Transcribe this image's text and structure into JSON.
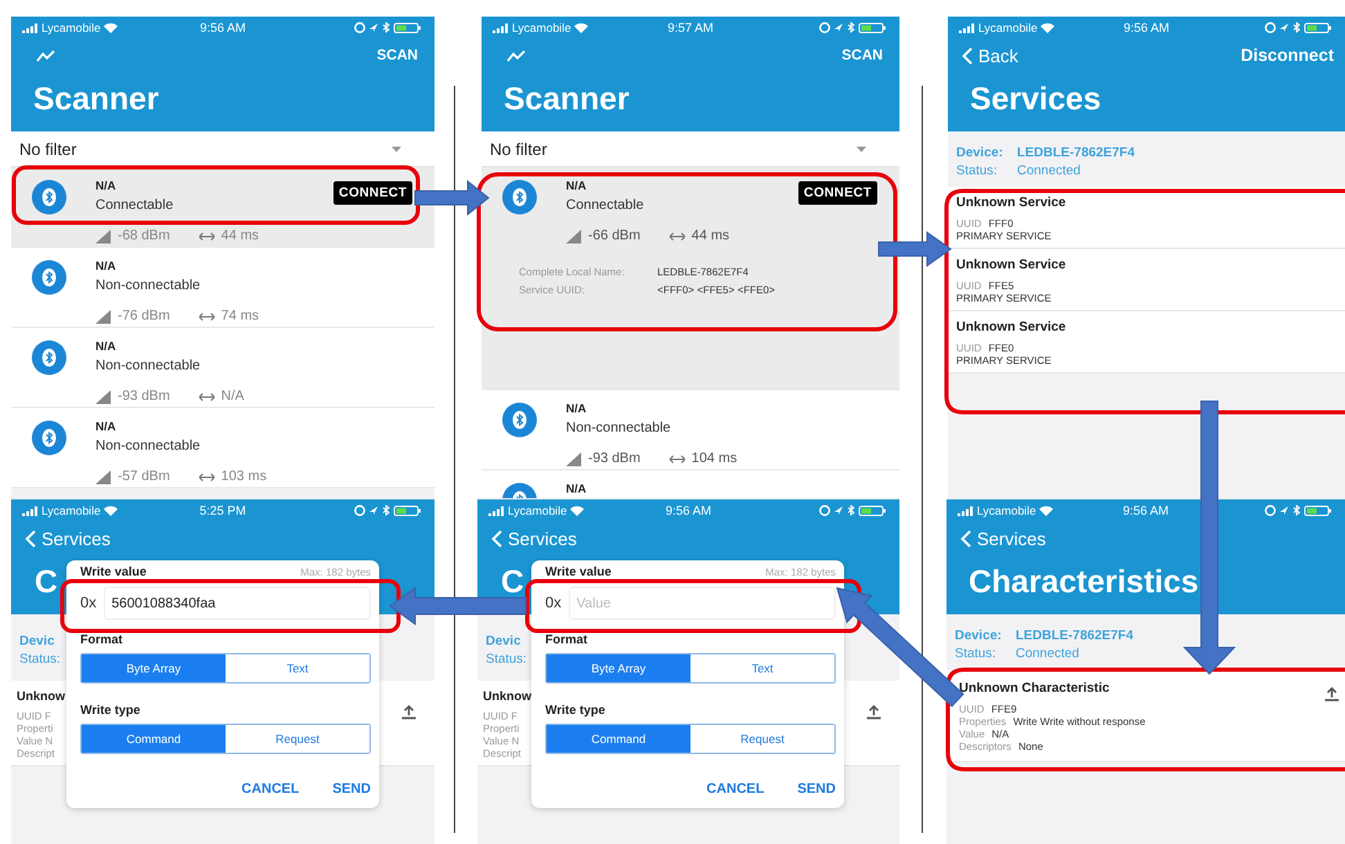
{
  "panels": [
    {
      "kind": "scanner",
      "carrier": "Lycamobile",
      "time": "9:56 AM",
      "action": "SCAN",
      "title": "Scanner",
      "filter": "No filter",
      "devices": [
        {
          "name": "N/A",
          "type": "Connectable",
          "rssi": "-68 dBm",
          "interval": "44 ms",
          "button": "CONNECT",
          "selected": true
        },
        {
          "name": "N/A",
          "type": "Non-connectable",
          "rssi": "-76 dBm",
          "interval": "74 ms",
          "selected": false
        },
        {
          "name": "N/A",
          "type": "Non-connectable",
          "rssi": "-93 dBm",
          "interval": "N/A",
          "selected": false
        },
        {
          "name": "N/A",
          "type": "Non-connectable",
          "rssi": "-57 dBm",
          "interval": "103 ms",
          "selected": false
        }
      ]
    },
    {
      "kind": "scanner",
      "carrier": "Lycamobile",
      "time": "9:57 AM",
      "action": "SCAN",
      "title": "Scanner",
      "filter": "No filter",
      "devices": [
        {
          "name": "N/A",
          "type": "Connectable",
          "rssi": "-66 dBm",
          "interval": "44 ms",
          "button": "CONNECT",
          "details": [
            {
              "label": "Complete Local Name:",
              "value": "LEDBLE-7862E7F4"
            },
            {
              "label": "Service UUID:",
              "value": "<FFF0> <FFE5> <FFE0>"
            }
          ],
          "selected": true
        },
        {
          "name": "N/A",
          "type": "Non-connectable",
          "rssi": "-93 dBm",
          "interval": "104 ms",
          "selected": false
        },
        {
          "name": "N/A",
          "selected": false
        }
      ]
    },
    {
      "kind": "services",
      "carrier": "Lycamobile",
      "time": "9:56 AM",
      "back": "Back",
      "action": "Disconnect",
      "title": "Services",
      "device_label": "Device:",
      "device": "LEDBLE-7862E7F4",
      "status_label": "Status:",
      "status": "Connected",
      "services": [
        {
          "name": "Unknown Service",
          "uuid_label": "UUID",
          "uuid": "FFF0",
          "type": "PRIMARY SERVICE"
        },
        {
          "name": "Unknown Service",
          "uuid_label": "UUID",
          "uuid": "FFE5",
          "type": "PRIMARY SERVICE"
        },
        {
          "name": "Unknown Service",
          "uuid_label": "UUID",
          "uuid": "FFE0",
          "type": "PRIMARY SERVICE"
        }
      ]
    },
    {
      "kind": "write",
      "carrier": "Lycamobile",
      "time": "5:25 PM",
      "back": "Services",
      "title": "C",
      "device_label": "Devic",
      "status_label": "Status:",
      "row": [
        "Unknow",
        "UUID F",
        "Properti",
        "Value N",
        "Descript"
      ],
      "dialog": {
        "title": "Write value",
        "max": "Max: 182 bytes",
        "prefix": "0x",
        "value": "56001088340faa",
        "format_label": "Format",
        "formats": [
          {
            "label": "Byte Array",
            "selected": true
          },
          {
            "label": "Text",
            "selected": false
          }
        ],
        "type_label": "Write type",
        "types": [
          {
            "label": "Command",
            "selected": true
          },
          {
            "label": "Request",
            "selected": false
          }
        ],
        "buttons": [
          "CANCEL",
          "SEND"
        ]
      }
    },
    {
      "kind": "write",
      "carrier": "Lycamobile",
      "time": "9:56 AM",
      "back": "Services",
      "title": "C",
      "device_label": "Devic",
      "status_label": "Status:",
      "row": [
        "Unknow",
        "UUID F",
        "Properti",
        "Value N",
        "Descript"
      ],
      "dialog": {
        "title": "Write value",
        "max": "Max: 182 bytes",
        "prefix": "0x",
        "placeholder": "Value",
        "format_label": "Format",
        "formats": [
          {
            "label": "Byte Array",
            "selected": true
          },
          {
            "label": "Text",
            "selected": false
          }
        ],
        "type_label": "Write type",
        "types": [
          {
            "label": "Command",
            "selected": true
          },
          {
            "label": "Request",
            "selected": false
          }
        ],
        "buttons": [
          "CANCEL",
          "SEND"
        ]
      }
    },
    {
      "kind": "characteristics",
      "carrier": "Lycamobile",
      "time": "9:56 AM",
      "back": "Services",
      "title": "Characteristics",
      "device_label": "Device:",
      "device": "LEDBLE-7862E7F4",
      "status_label": "Status:",
      "status": "Connected",
      "characteristic": {
        "name": "Unknown Characteristic",
        "fields": [
          {
            "label": "UUID",
            "value": "FFE9"
          },
          {
            "label": "Properties",
            "value": "Write Write without response"
          },
          {
            "label": "Value",
            "value": "N/A"
          },
          {
            "label": "Descriptors",
            "value": "None"
          }
        ]
      }
    }
  ]
}
